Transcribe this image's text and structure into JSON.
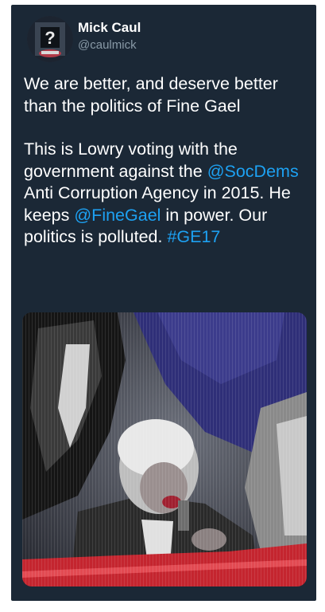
{
  "user": {
    "display_name": "Mick Caul",
    "handle": "@caulmick",
    "avatar_icon": "profile-photo-icon"
  },
  "tweet": {
    "para1": "We are better, and deserve better than the politics of Fine Gael",
    "para2": {
      "t1": "This is Lowry voting with the government against the ",
      "mention1": "@SocDems",
      "t2": " Anti Corruption Agency in 2015. He keeps ",
      "mention2": "@FineGael",
      "t3": " in power. Our politics is polluted. ",
      "hashtag": "#GE17"
    }
  },
  "colors": {
    "background": "#1b2836",
    "text": "#ffffff",
    "secondary": "#8899a6",
    "link": "#1da1f2"
  },
  "media": {
    "description_icon": "tweet-photo"
  }
}
